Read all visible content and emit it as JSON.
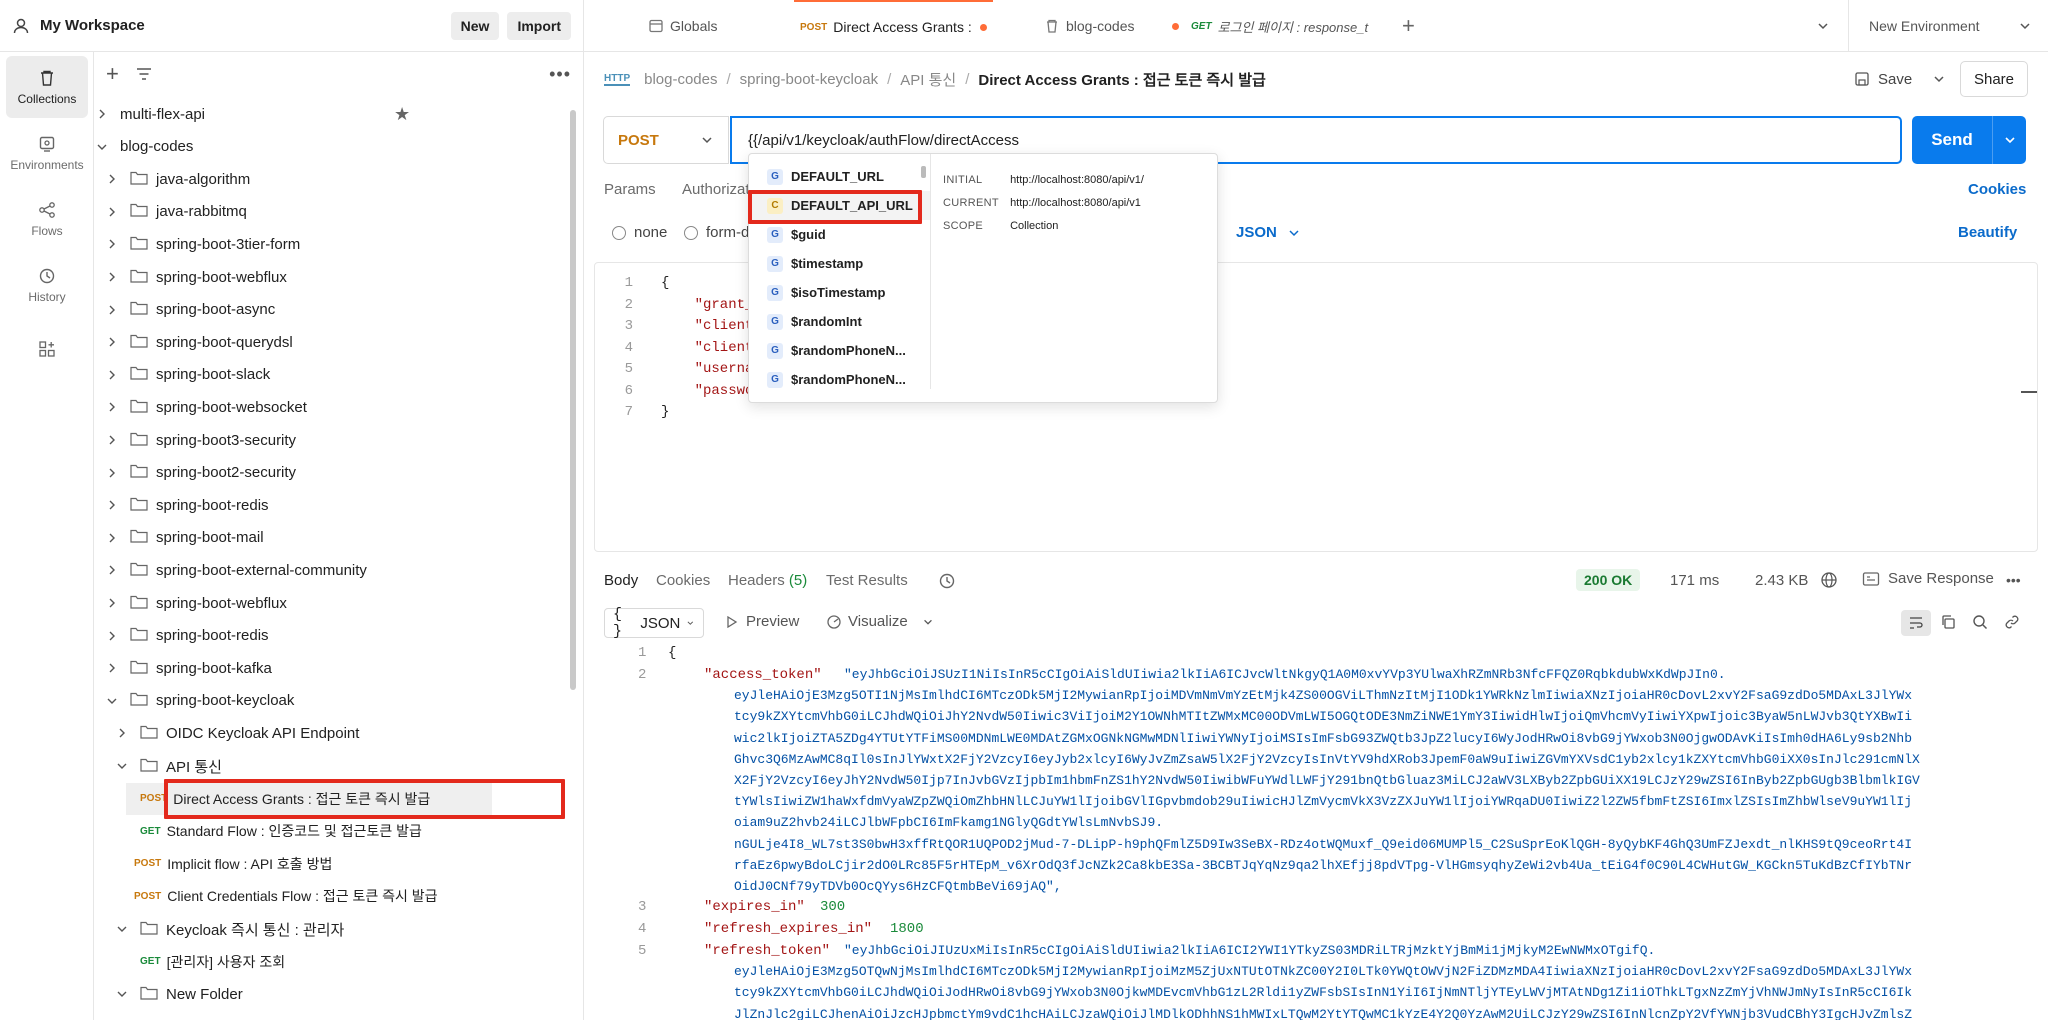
{
  "workspace": {
    "title": "My Workspace",
    "new_label": "New",
    "import_label": "Import"
  },
  "rail": {
    "collections": "Collections",
    "environments": "Environments",
    "flows": "Flows",
    "history": "History"
  },
  "tree": [
    {
      "label": "multi-flex-api",
      "depth": 0,
      "type": "collection",
      "chevron": "right",
      "starred": true
    },
    {
      "label": "blog-codes",
      "depth": 0,
      "type": "collection",
      "chevron": "down"
    },
    {
      "label": "java-algorithm",
      "depth": 1,
      "type": "folder",
      "chevron": "right"
    },
    {
      "label": "java-rabbitmq",
      "depth": 1,
      "type": "folder",
      "chevron": "right"
    },
    {
      "label": "spring-boot-3tier-form",
      "depth": 1,
      "type": "folder",
      "chevron": "right"
    },
    {
      "label": "spring-boot-webflux",
      "depth": 1,
      "type": "folder",
      "chevron": "right"
    },
    {
      "label": "spring-boot-async",
      "depth": 1,
      "type": "folder",
      "chevron": "right"
    },
    {
      "label": "spring-boot-querydsl",
      "depth": 1,
      "type": "folder",
      "chevron": "right"
    },
    {
      "label": "spring-boot-slack",
      "depth": 1,
      "type": "folder",
      "chevron": "right"
    },
    {
      "label": "spring-boot-websocket",
      "depth": 1,
      "type": "folder",
      "chevron": "right"
    },
    {
      "label": "spring-boot3-security",
      "depth": 1,
      "type": "folder",
      "chevron": "right"
    },
    {
      "label": "spring-boot2-security",
      "depth": 1,
      "type": "folder",
      "chevron": "right"
    },
    {
      "label": "spring-boot-redis",
      "depth": 1,
      "type": "folder",
      "chevron": "right"
    },
    {
      "label": "spring-boot-mail",
      "depth": 1,
      "type": "folder",
      "chevron": "right"
    },
    {
      "label": "spring-boot-external-community",
      "depth": 1,
      "type": "folder",
      "chevron": "right"
    },
    {
      "label": "spring-boot-webflux",
      "depth": 1,
      "type": "folder",
      "chevron": "right"
    },
    {
      "label": "spring-boot-redis",
      "depth": 1,
      "type": "folder",
      "chevron": "right"
    },
    {
      "label": "spring-boot-kafka",
      "depth": 1,
      "type": "folder",
      "chevron": "right"
    },
    {
      "label": "spring-boot-keycloak",
      "depth": 1,
      "type": "folder",
      "chevron": "down"
    },
    {
      "label": "OIDC Keycloak API Endpoint",
      "depth": 2,
      "type": "folder",
      "chevron": "right"
    },
    {
      "label": "API 통신",
      "depth": 2,
      "type": "folder",
      "chevron": "down"
    },
    {
      "label": "Direct Access Grants : 접근 토큰 즉시 발급",
      "depth": 3,
      "type": "request",
      "method": "POST",
      "selected": true
    },
    {
      "label": "Standard Flow : 인증코드 및 접근토큰 발급",
      "depth": 3,
      "type": "request",
      "method": "GET"
    },
    {
      "label": "Implicit flow : API 호출 방법",
      "depth": 2,
      "type": "request",
      "method": "POST"
    },
    {
      "label": "Client Credentials Flow : 접근 토큰 즉시 발급",
      "depth": 2,
      "type": "request",
      "method": "POST"
    },
    {
      "label": "Keycloak 즉시 통신 : 관리자",
      "depth": 2,
      "type": "folder",
      "chevron": "down"
    },
    {
      "label": "[관리자] 사용자 조회",
      "depth": 3,
      "type": "request",
      "method": "GET"
    },
    {
      "label": "New Folder",
      "depth": 2,
      "type": "folder",
      "chevron": "down"
    }
  ],
  "tabs": {
    "globals": "Globals",
    "active_method": "POST",
    "active": "Direct Access Grants :",
    "blog": "blog-codes",
    "login_method": "GET",
    "login": "로그인 페이지 : response_t",
    "environment": "New Environment"
  },
  "breadcrumb": [
    "blog-codes",
    "spring-boot-keycloak",
    "API 통신",
    "Direct Access Grants : 접근 토큰 즉시 발급"
  ],
  "save_label": "Save",
  "share_label": "Share",
  "request": {
    "method": "POST",
    "url": "{{/api/v1/keycloak/authFlow/directAccess",
    "send_label": "Send",
    "tabs": [
      "Params",
      "Authorizat"
    ],
    "cookies": "Cookies",
    "body_modes": [
      "none",
      "form-d"
    ],
    "body_format": "JSON",
    "beautify": "Beautify"
  },
  "autocomplete": {
    "items": [
      {
        "badge": "G",
        "name": "DEFAULT_URL"
      },
      {
        "badge": "C",
        "name": "DEFAULT_API_URL",
        "highlighted": true
      },
      {
        "badge": "G",
        "name": "$guid"
      },
      {
        "badge": "G",
        "name": "$timestamp"
      },
      {
        "badge": "G",
        "name": "$isoTimestamp"
      },
      {
        "badge": "G",
        "name": "$randomInt"
      },
      {
        "badge": "G",
        "name": "$randomPhoneN..."
      },
      {
        "badge": "G",
        "name": "$randomPhoneN..."
      }
    ],
    "initial_label": "INITIAL",
    "initial_value": "http://localhost:8080/api/v1/",
    "current_label": "CURRENT",
    "current_value": "http://localhost:8080/api/v1",
    "scope_label": "SCOPE",
    "scope_value": "Collection"
  },
  "editor": {
    "line_numbers": [
      "1",
      "2",
      "3",
      "4",
      "5",
      "6",
      "7"
    ],
    "lines": [
      "{",
      "    \"grant_",
      "    \"client",
      "    \"client",
      "    \"userna",
      "    \"passwo",
      "}"
    ]
  },
  "response": {
    "tabs": {
      "body": "Body",
      "cookies": "Cookies",
      "headers": "Headers",
      "headers_count": "(5)",
      "tests": "Test Results"
    },
    "status": "200 OK",
    "time": "171 ms",
    "size": "2.43 KB",
    "save": "Save Response",
    "format": "JSON",
    "preview": "Preview",
    "visualize": "Visualize",
    "line_numbers": [
      "1",
      "2",
      "3",
      "4",
      "5"
    ],
    "brace": "{",
    "access_key": "\"access_token\"",
    "access_lines": [
      "\"eyJhbGciOiJSUzI1NiIsInR5cCIgOiAiSldUIiwia2lkIiA6ICJvcWltNkgyQ1A0M0xvYVp3YUlwaXhRZmNRb3NfcFFQZ0RqbkdubWxKdWpJIn0.",
      "eyJleHAiOjE3Mzg5OTI1NjMsImlhdCI6MTczODk5MjI2MywianRpIjoiMDVmNmVmYzEtMjk4ZS00OGViLThmNzItMjI1ODk1YWRkNzlmIiwiaXNzIjoiaHR0cDovL2xvY2FsaG9zdDo5MDAxL3JlYWx",
      "tcy9kZXYtcmVhbG0iLCJhdWQiOiJhY2NvdW50Iiwic3ViIjoiM2Y1OWNhMTItZWMxMC00ODVmLWI5OGQtODE3NmZiNWE1YmY3IiwidHlwIjoiQmVhcmVyIiwiYXpwIjoic3ByaW5nLWJvb3QtYXBwIi",
      "wic2lkIjoiZTA5ZDg4YTUtYTFiMS00MDNmLWE0MDAtZGMxOGNkNGMwMDNlIiwiYWNyIjoiMSIsImFsbG93ZWQtb3JpZ2lucyI6WyJodHRwOi8vbG9jYWxob3N0OjgwODAvKiIsImh0dHA6Ly9sb2Nhb",
      "Ghvc3Q6MzAwMC8qIl0sInJlYWxtX2FjY2VzcyI6eyJyb2xlcyI6WyJvZmZsaW5lX2FjY2VzcyIsInVtYV9hdXRob3JpemF0aW9uIiwiZGVmYXVsdC1yb2xlcy1kZXYtcmVhbG0iXX0sInJlc291cmNlX",
      "X2FjY2VzcyI6eyJhY2NvdW50Ijp7InJvbGVzIjpbIm1hbmFnZS1hY2NvdW50IiwibWFuYWdlLWFjY291bnQtbGluaz3MiLCJ2aWV3LXByb2ZpbGUiXX19LCJzY29wZSI6InByb2ZpbGUgb3BlbmlkIGV",
      "tYWlsIiwiZW1haWxfdmVyaWZpZWQiOmZhbHNlLCJuYW1lIjoibGVlIGpvbmdob29uIiwicHJlZmVycmVkX3VzZXJuYW1lIjoiYWRqaDU0IiwiZ2l2ZW5fbmFtZSI6ImxlZSIsImZhbWlseV9uYW1lIj",
      "oiam9uZ2hvb24iLCJlbWFpbCI6ImFkamg1NGlyQGdtYWlsLmNvbSJ9.",
      "nGULje4I8_WL7st3S0bwH3xffRtQOR1UQPOD2jMud-7-DLipP-h9phQFmlZ5D9Iw3SeBX-RDz4otWQMuxf_Q9eid06MUMPl5_C2SuSprEoKlQGH-8yQybKF4GhQ3UmFZJexdt_nlKHS9tQ9ceoRrt4I",
      "rfaEz6pwyBdoLCjir2dO0LRc85F5rHTEpM_v6XrOdQ3fJcNZk2Ca8kbE3Sa-3BCBTJqYqNz9qa2lhXEfjj8pdVTpg-VlHGmsyqhyZeWi2vb4Ua_tEiG4f0C90L4CWHutGW_KGCkn5TuKdBzCfIYbTNr",
      "OidJ0CNf79yTDVb0OcQYys6HzCFQtmbBeVi69jAQ\","
    ],
    "expires_key": "\"expires_in\"",
    "expires_val": "300",
    "refresh_expires_key": "\"refresh_expires_in\"",
    "refresh_expires_val": "1800",
    "refresh_key": "\"refresh_token\"",
    "refresh_lines": [
      "\"eyJhbGciOiJIUzUxMiIsInR5cCIgOiAiSldUIiwia2lkIiA6ICI2YWI1YTkyZS03MDRiLTRjMzktYjBmMi1jMjkyM2EwNWMxOTgifQ.",
      "eyJleHAiOjE3Mzg5OTQwNjMsImlhdCI6MTczODk5MjI2MywianRpIjoiMzM5ZjUxNTUtOTNkZC00Y2I0LTk0YWQtOWVjN2FiZDMzMDA4IiwiaXNzIjoiaHR0cDovL2xvY2FsaG9zdDo5MDAxL3JlYWx",
      "tcy9kZXYtcmVhbG0iLCJhdWQiOiJodHRwOi8vbG9jYWxob3N0OjkwMDEvcmVhbG1zL2Rldi1yZWFsbSIsInN1YiI6IjNmNTljYTEyLWVjMTAtNDg1Zi1iOThkLTgxNzZmYjVhNWJmNyIsInR5cCI6Ik",
      "JlZnJlc2giLCJhenAiOiJzcHJpbmctYm9vdC1hcHAiLCJzaWQiOiJlMDlkODhhNS1hMWIxLTQwM2YtYTQwMC1kYzE4Y2Q0YzAwM2UiLCJzY29wZSI6InNlcnZpY2VfYWNjb3VudCBhY3IgcHJvZmlsZ"
    ]
  }
}
